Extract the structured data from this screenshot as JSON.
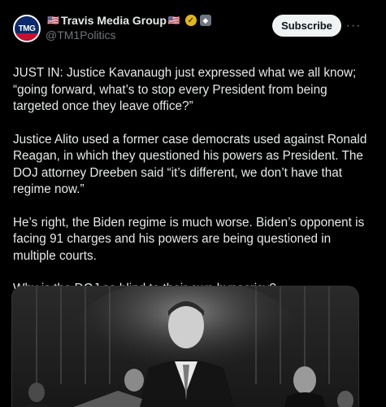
{
  "author": {
    "avatar_text": "TMG",
    "name": "Travis Media Group",
    "flag_left": "🇺🇸",
    "flag_right": "🇺🇸",
    "verified_icon": "check",
    "handle": "@TM1Politics"
  },
  "actions": {
    "subscribe_label": "Subscribe",
    "more_label": "···"
  },
  "tweet": {
    "paragraphs": [
      "JUST IN: Justice Kavanaugh just expressed what we all know; “going forward, what’s to stop every President from being targeted once they leave office?”",
      "Justice Alito used a former case democrats used against Ronald Reagan, in which they questioned his powers as President.  The DOJ attorney Dreeben said “it’s different, we don’t have that regime now.”",
      "He’s right, the Biden regime is much worse.  Biden’s opponent is facing 91 charges and his powers are being questioned in multiple courts.",
      "Why is the DOJ so blind to their own hypocrisy?"
    ]
  },
  "colors": {
    "background": "#000000",
    "text": "#e7e9ea",
    "muted": "#71767b",
    "subscribe_bg": "#eff3f4",
    "verified": "#e2b719"
  }
}
